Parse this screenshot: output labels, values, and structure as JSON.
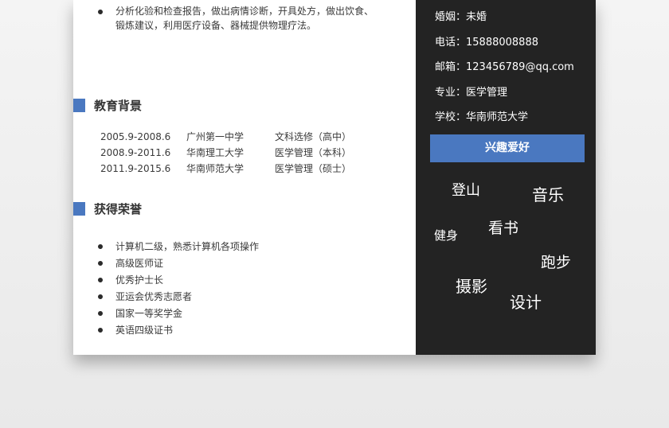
{
  "work": {
    "bullets": [
      "分析化验和检查报告，做出病情诊断，开具处方，做出饮食、锻炼建议，利用医疗设备、器械提供物理疗法。"
    ]
  },
  "education": {
    "title": "教育背景",
    "rows": [
      {
        "period": "2005.9-2008.6",
        "school": "广州第一中学",
        "major": "文科选修（高中）"
      },
      {
        "period": "2008.9-2011.6",
        "school": "华南理工大学",
        "major": "医学管理（本科）"
      },
      {
        "period": "2011.9-2015.6",
        "school": "华南师范大学",
        "major": "医学管理（硕士）"
      }
    ]
  },
  "honors": {
    "title": "获得荣誉",
    "items": [
      "计算机二级，熟悉计算机各项操作",
      "高级医师证",
      "优秀护士长",
      "亚运会优秀志愿者",
      "国家一等奖学金",
      "英语四级证书"
    ]
  },
  "profile": {
    "marriage": "婚姻：未婚",
    "phone": "电话：15888008888",
    "email": "邮箱：123456789@qq.com",
    "major": "专业：医学管理",
    "school": "学校：华南师范大学"
  },
  "hobbies": {
    "title": "兴趣爱好",
    "items": [
      "登山",
      "音乐",
      "健身",
      "看书",
      "跑步",
      "摄影",
      "设计"
    ]
  },
  "colors": {
    "accent": "#4a78c0",
    "sidebar": "#232323"
  }
}
